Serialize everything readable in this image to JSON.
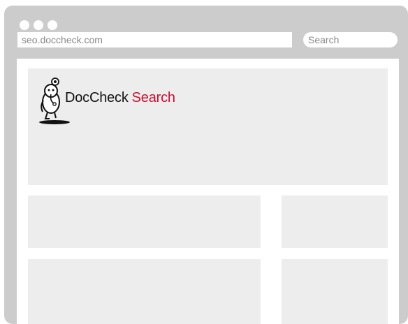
{
  "window_controls": {
    "dots": [
      "window-dot",
      "window-dot",
      "window-dot"
    ]
  },
  "address_bar": {
    "url": "seo.doccheck.com"
  },
  "search": {
    "placeholder": "Search"
  },
  "page": {
    "logo": {
      "brand_main": "DocCheck",
      "brand_accent": "Search",
      "accent_color": "#c8102e",
      "mascot_icon": "doccheck-mascot-icon"
    }
  },
  "colors": {
    "frame": "#cccccc",
    "placeholder_panel": "#ededed"
  }
}
